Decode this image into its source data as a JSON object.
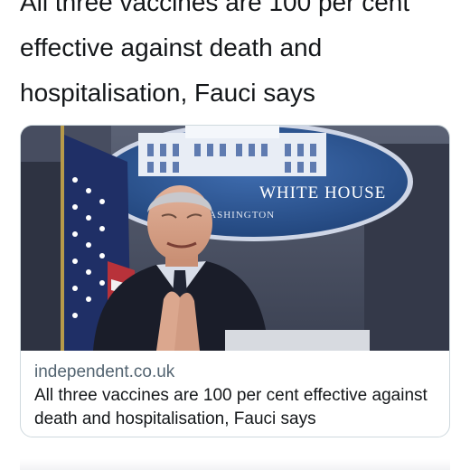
{
  "tweet": {
    "text": "All three vaccines are 100 per cent\neffective against death and\nhospitalisation, Fauci says"
  },
  "link_card": {
    "domain": "independent.co.uk",
    "title": "All three vaccines are 100 per cent effective against death and hospitalisation, Fauci says",
    "image": {
      "seal_line1": "WHITE HOUSE",
      "seal_line2": "WASHINGTON"
    }
  },
  "colors": {
    "text": "#14171a",
    "secondary_text": "#536471",
    "card_border": "#cfd9de",
    "seal_blue": "#2f5b98"
  }
}
